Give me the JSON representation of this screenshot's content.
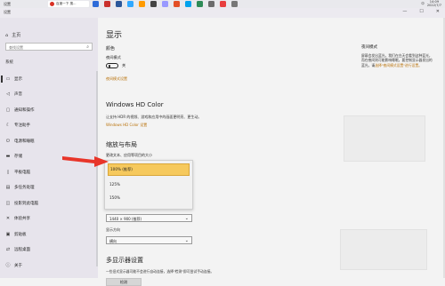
{
  "taskbar": {
    "left_label": "设置",
    "chrome_tab": "百度一下 搜...",
    "tray": {
      "ime": "中",
      "time": "14:09",
      "date": "2022/7/7"
    }
  },
  "window": {
    "title": "设置",
    "controls": [
      "—",
      "☐",
      "✕"
    ]
  },
  "sidebar": {
    "home_label": "主页",
    "search_placeholder": "查找设置",
    "section_label": "系统",
    "items": [
      {
        "icon": "display-icon",
        "label": "显示"
      },
      {
        "icon": "sound-icon",
        "label": "声音"
      },
      {
        "icon": "notifications-icon",
        "label": "通知和操作"
      },
      {
        "icon": "focus-assist-icon",
        "label": "专注助手"
      },
      {
        "icon": "power-icon",
        "label": "电源和睡眠"
      },
      {
        "icon": "storage-icon",
        "label": "存储"
      },
      {
        "icon": "tablet-icon",
        "label": "平板电脑"
      },
      {
        "icon": "multitasking-icon",
        "label": "多任务处理"
      },
      {
        "icon": "projecting-icon",
        "label": "投影到此电脑"
      },
      {
        "icon": "shared-experiences-icon",
        "label": "体验共享"
      },
      {
        "icon": "clipboard-icon",
        "label": "剪贴板"
      },
      {
        "icon": "remote-desktop-icon",
        "label": "远程桌面"
      },
      {
        "icon": "about-icon",
        "label": "关于"
      }
    ]
  },
  "main": {
    "title": "显示",
    "brightness_heading": "颜色",
    "night_light_label": "夜间模式",
    "night_light_state": "关",
    "night_light_link": "夜间模式设置",
    "hd_heading": "Windows HD Color",
    "hd_desc": "让支持 HDR 的视频、游戏和应用中的画面更明亮、更生动。",
    "hd_link": "Windows HD Color 设置",
    "scale_heading": "缩放与布局",
    "scale_label": "更改文本、应用等项目的大小",
    "scale_options": [
      "100% (推荐)",
      "125%",
      "150%"
    ],
    "resolution_value": "1440 × 900 (推荐)",
    "orientation_label": "显示方向",
    "orientation_value": "横向",
    "multi_heading": "多显示器设置",
    "multi_desc": "一些旧式显示器可能不会进行自动连接，选择\"检测\"即可尝试手动连接。",
    "detect_button": "检测"
  },
  "help": {
    "title": "夜间模式",
    "text": "屏幕会发出蓝光，我们在白天会看到这种蓝光，而在夜间则可能影响睡眠。要控制显示器发出的蓝光，请",
    "link": "选择\"夜间模式设置\"进行设置。"
  },
  "colors": {
    "accent": "#b9720a",
    "selected_option": "#f6c95d",
    "arrow": "#e8352a"
  }
}
